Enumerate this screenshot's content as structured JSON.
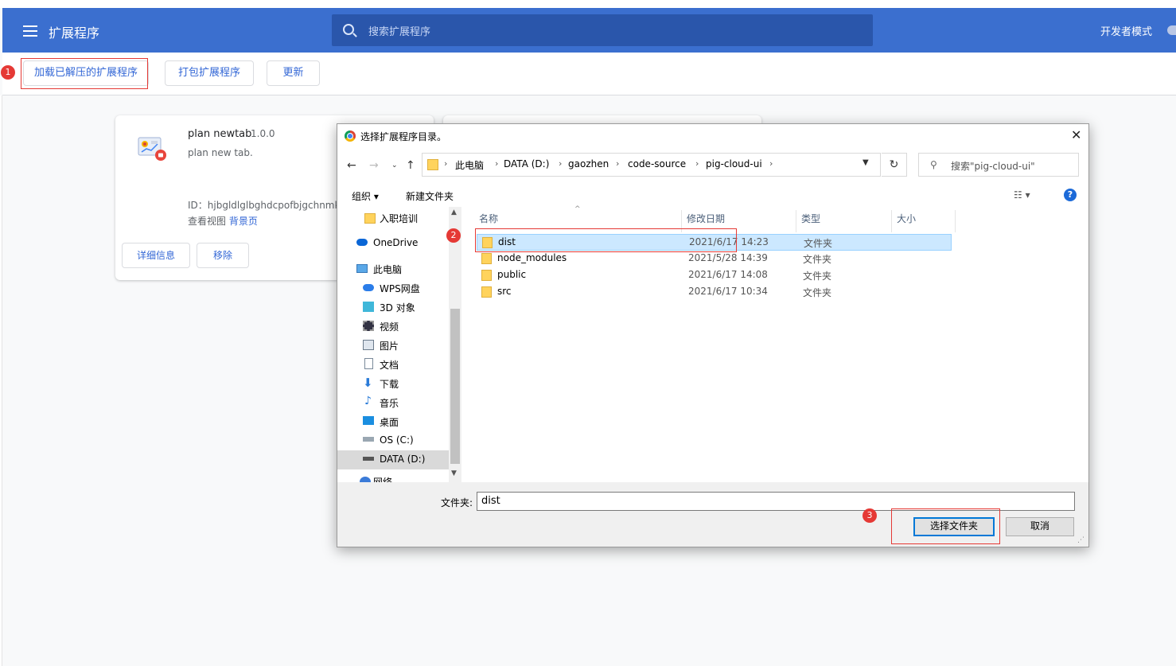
{
  "header": {
    "title": "扩展程序",
    "search_placeholder": "搜索扩展程序",
    "dev_mode_label": "开发者模式"
  },
  "toolbar": {
    "load_unpacked": "加载已解压的扩展程序",
    "pack": "打包扩展程序",
    "update": "更新"
  },
  "extension": {
    "name": "plan newtab",
    "version": "1.0.0",
    "description": "plan new tab.",
    "id": "ID：hjbgldlglbghdcpofbjgchnmk",
    "inspect_label": "查看视图",
    "background_link": "背景页",
    "details_button": "详细信息",
    "remove_button": "移除"
  },
  "annotations": {
    "step1": "1",
    "step2": "2",
    "step3": "3"
  },
  "dialog": {
    "title": "选择扩展程序目录。",
    "breadcrumbs": [
      "此电脑",
      "DATA (D:)",
      "gaozhen",
      "code-source",
      "pig-cloud-ui"
    ],
    "search_placeholder": "搜索\"pig-cloud-ui\"",
    "organize": "组织 ▾",
    "new_folder": "新建文件夹",
    "nav_items": [
      "入职培训",
      "OneDrive",
      "此电脑",
      "WPS网盘",
      "3D 对象",
      "视频",
      "图片",
      "文档",
      "下载",
      "音乐",
      "桌面",
      "OS (C:)",
      "DATA (D:)",
      "网络"
    ],
    "columns": {
      "name": "名称",
      "date": "修改日期",
      "type": "类型",
      "size": "大小"
    },
    "files": [
      {
        "name": "dist",
        "date": "2021/6/17 14:23",
        "type": "文件夹"
      },
      {
        "name": "node_modules",
        "date": "2021/5/28 14:39",
        "type": "文件夹"
      },
      {
        "name": "public",
        "date": "2021/6/17 14:08",
        "type": "文件夹"
      },
      {
        "name": "src",
        "date": "2021/6/17 10:34",
        "type": "文件夹"
      }
    ],
    "folder_label": "文件夹:",
    "folder_value": "dist",
    "select_button": "选择文件夹",
    "cancel_button": "取消"
  }
}
